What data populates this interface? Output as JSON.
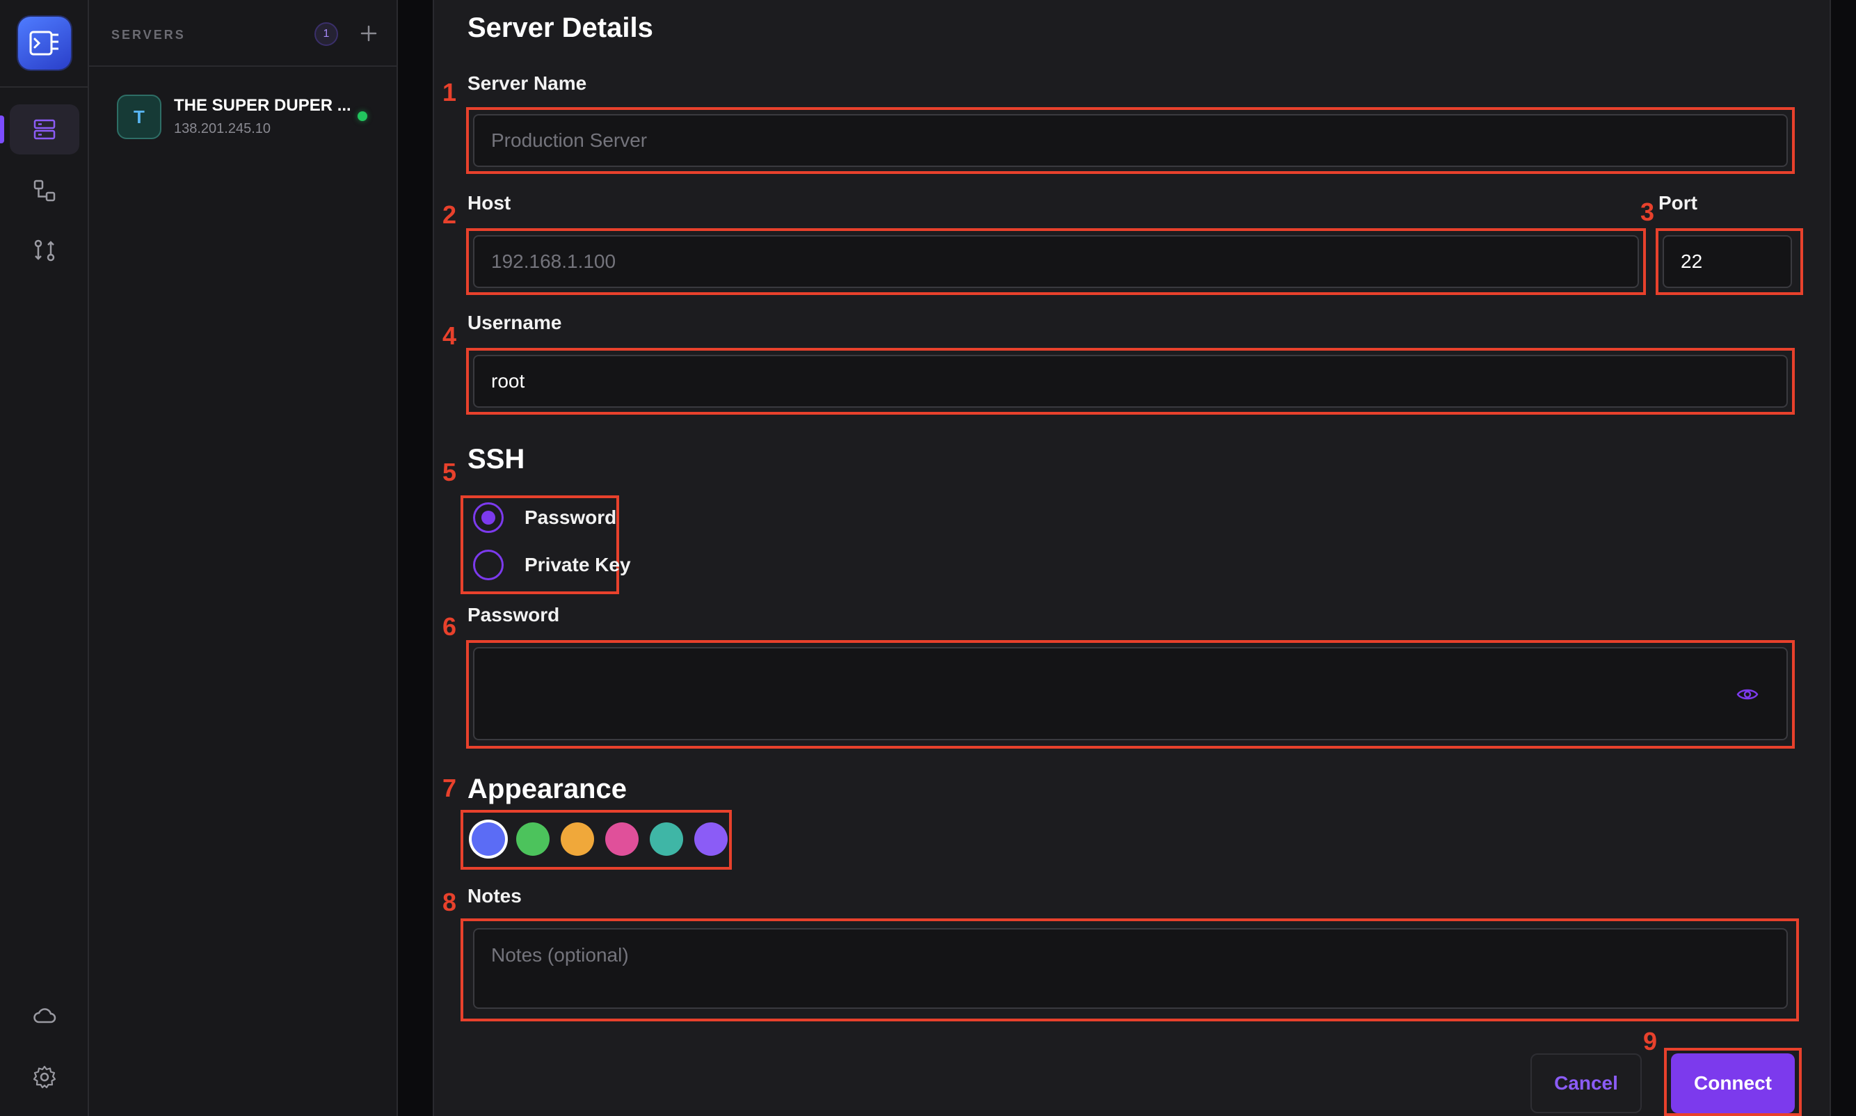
{
  "sidebar": {
    "nav": [
      "servers-icon",
      "connections-icon",
      "transfer-icon"
    ],
    "bottom": [
      "cloud-icon",
      "gear-icon"
    ]
  },
  "servers_panel": {
    "title": "SERVERS",
    "count": "1",
    "add_label": "+",
    "items": [
      {
        "initial": "T",
        "name": "THE SUPER DUPER ...",
        "ip": "138.201.245.10",
        "status": "online"
      }
    ]
  },
  "form": {
    "title": "Server Details",
    "server_name": {
      "label": "Server Name",
      "placeholder": "Production Server",
      "value": ""
    },
    "host": {
      "label": "Host",
      "placeholder": "192.168.1.100",
      "value": ""
    },
    "port": {
      "label": "Port",
      "value": "22"
    },
    "username": {
      "label": "Username",
      "value": "root"
    },
    "ssh": {
      "title": "SSH",
      "options": [
        {
          "label": "Password",
          "selected": true
        },
        {
          "label": "Private Key",
          "selected": false
        }
      ]
    },
    "password": {
      "label": "Password",
      "value": ""
    },
    "appearance": {
      "title": "Appearance",
      "colors": [
        "#5b6cf5",
        "#4cc35c",
        "#f0a83a",
        "#e0509a",
        "#3fb6a6",
        "#8b5cf6"
      ],
      "selected_index": 0
    },
    "notes": {
      "label": "Notes",
      "placeholder": "Notes (optional)",
      "value": ""
    },
    "cancel_label": "Cancel",
    "connect_label": "Connect"
  },
  "annotations": [
    "1",
    "2",
    "3",
    "4",
    "5",
    "6",
    "7",
    "8",
    "9"
  ],
  "colors": {
    "accent": "#7c3aed",
    "marker": "#e8412c",
    "online": "#22c55e"
  }
}
